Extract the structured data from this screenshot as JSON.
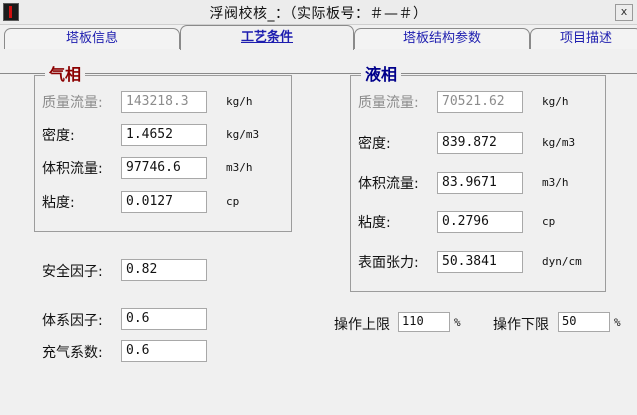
{
  "window": {
    "title": "浮阀校核_：（实际板号：＃—＃）",
    "close_glyph": "x"
  },
  "tabs": [
    {
      "label": "塔板信息"
    },
    {
      "label": "工艺条件"
    },
    {
      "label": "塔板结构参数"
    },
    {
      "label": "项目描述"
    }
  ],
  "gas": {
    "title": "气相",
    "title_color": "#8b0000",
    "rows": [
      {
        "label": "质量流量:",
        "value": "143218.3",
        "unit": "kg/h"
      },
      {
        "label": "密度:",
        "value": "1.4652",
        "unit": "kg/m3"
      },
      {
        "label": "体积流量:",
        "value": "97746.6",
        "unit": "m3/h"
      },
      {
        "label": "粘度:",
        "value": "0.0127",
        "unit": "cp"
      }
    ]
  },
  "liquid": {
    "title": "液相",
    "title_color": "#00008b",
    "rows": [
      {
        "label": "质量流量:",
        "value": "70521.62",
        "unit": "kg/h"
      },
      {
        "label": "密度:",
        "value": "839.872",
        "unit": "kg/m3"
      },
      {
        "label": "体积流量:",
        "value": "83.9671",
        "unit": "m3/h"
      },
      {
        "label": "粘度:",
        "value": "0.2796",
        "unit": "cp"
      },
      {
        "label": "表面张力:",
        "value": "50.3841",
        "unit": "dyn/cm"
      }
    ]
  },
  "factors": {
    "safety": {
      "label": "安全因子:",
      "value": "0.82"
    },
    "system": {
      "label": "体系因子:",
      "value": "0.6"
    },
    "aeration": {
      "label": "充气系数:",
      "value": "0.6"
    }
  },
  "operation": {
    "upper": {
      "label": "操作上限",
      "value": "110",
      "unit": "%"
    },
    "lower": {
      "label": "操作下限",
      "value": "50",
      "unit": "%"
    }
  }
}
